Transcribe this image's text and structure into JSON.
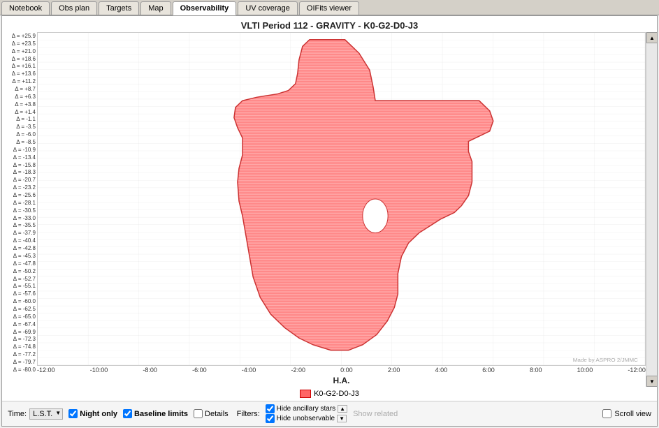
{
  "tabs": [
    {
      "label": "Notebook",
      "active": false
    },
    {
      "label": "Obs plan",
      "active": false
    },
    {
      "label": "Targets",
      "active": false
    },
    {
      "label": "Map",
      "active": false
    },
    {
      "label": "Observability",
      "active": true
    },
    {
      "label": "UV coverage",
      "active": false
    },
    {
      "label": "OIFits viewer",
      "active": false
    }
  ],
  "chart": {
    "title": "VLTI Period 112 - GRAVITY - K0-G2-D0-J3",
    "ha_label": "H.A.",
    "watermark": "Made by ASPRO 2/JMMC",
    "x_labels": [
      "-12:00",
      "-10:00",
      "-8:00",
      "-6:00",
      "-4:00",
      "-2:00",
      "0:00",
      "2:00",
      "4:00",
      "6:00",
      "8:00",
      "10:00",
      "-12:00"
    ],
    "y_labels": [
      "Δ = +25.9",
      "Δ = +23.5",
      "Δ = +21.0",
      "Δ = +18.6",
      "Δ = +16.1",
      "Δ = +13.6",
      "Δ = +11.2",
      "Δ = +8.7",
      "Δ = +6.3",
      "Δ = +3.8",
      "Δ = +1.4",
      "Δ = -1.1",
      "Δ = -3.5",
      "Δ = -6.0",
      "Δ = -8.5",
      "Δ = -10.9",
      "Δ = -13.4",
      "Δ = -15.8",
      "Δ = -18.3",
      "Δ = -20.7",
      "Δ = -23.2",
      "Δ = -25.6",
      "Δ = -28.1",
      "Δ = -30.5",
      "Δ = -33.0",
      "Δ = -35.5",
      "Δ = -37.9",
      "Δ = -40.4",
      "Δ = -42.8",
      "Δ = -45.3",
      "Δ = -47.8",
      "Δ = -50.2",
      "Δ = -52.7",
      "Δ = -55.1",
      "Δ = -57.6",
      "Δ = -60.0",
      "Δ = -62.5",
      "Δ = -65.0",
      "Δ = -67.4",
      "Δ = -69.9",
      "Δ = -72.3",
      "Δ = -74.8",
      "Δ = -77.2",
      "Δ = -79.7",
      "Δ = -80.0"
    ]
  },
  "legend": {
    "items": [
      {
        "label": "K0-G2-D0-J3",
        "color": "#ff6666",
        "border": "#cc0000"
      }
    ]
  },
  "bottom_bar": {
    "time_label": "Time:",
    "lst_value": "L.S.T.",
    "night_only_label": "Night only",
    "baseline_limits_label": "Baseline limits",
    "details_label": "Details",
    "filters_label": "Filters:",
    "hide_ancillary_label": "Hide ancillary stars",
    "hide_unobservable_label": "Hide unobservable",
    "show_related_label": "Show related",
    "scroll_view_label": "Scroll view",
    "night_only_checked": true,
    "baseline_limits_checked": true,
    "details_checked": false,
    "hide_ancillary_checked": true,
    "hide_unobservable_checked": true,
    "scroll_view_checked": false
  }
}
